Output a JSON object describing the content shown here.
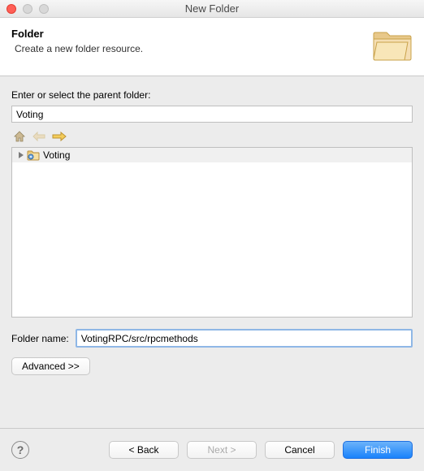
{
  "window": {
    "title": "New Folder"
  },
  "header": {
    "title": "Folder",
    "subtitle": "Create a new folder resource."
  },
  "parent": {
    "label": "Enter or select the parent folder:",
    "value": "Voting"
  },
  "tree": {
    "items": [
      {
        "label": "Voting"
      }
    ]
  },
  "folderName": {
    "label": "Folder name:",
    "value": "VotingRPC/src/rpcmethods"
  },
  "advanced": {
    "label": "Advanced >>"
  },
  "buttons": {
    "back": "< Back",
    "next": "Next >",
    "cancel": "Cancel",
    "finish": "Finish"
  }
}
